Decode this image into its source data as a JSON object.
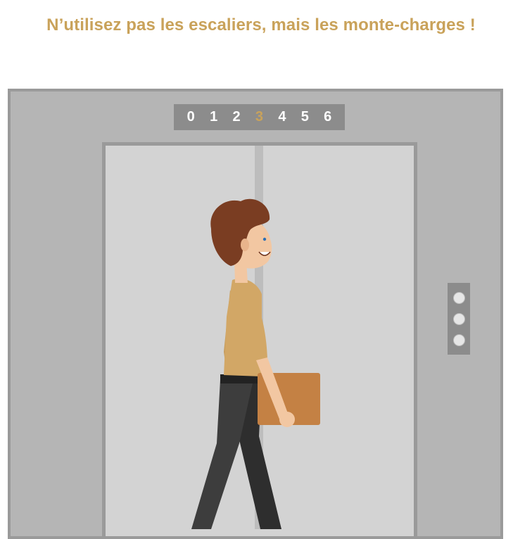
{
  "headline": "N’utilisez pas les escaliers, mais les monte-charges !",
  "indicator": {
    "floors": [
      "0",
      "1",
      "2",
      "3",
      "4",
      "5",
      "6"
    ],
    "active_floor": "3"
  },
  "call_panel": {
    "buttons": [
      "call-button-1",
      "call-button-2",
      "call-button-3"
    ]
  },
  "colors": {
    "accent": "#c9a25a",
    "frame": "#b5b5b5",
    "doors": "#d3d3d3",
    "box": "#c48144",
    "shirt": "#d2a766",
    "hair": "#7a3d22",
    "pants": "#3d3d3d"
  }
}
